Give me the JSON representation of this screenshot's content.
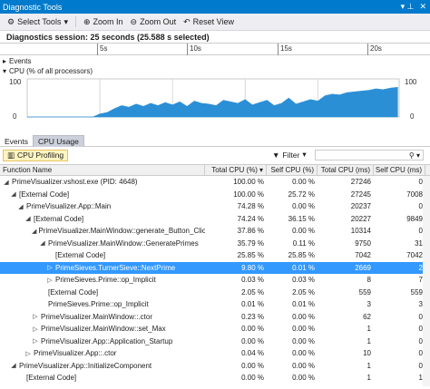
{
  "window": {
    "title": "Diagnostic Tools",
    "title_icons": [
      "pin-icon",
      "close-icon"
    ]
  },
  "toolbar": {
    "select_tools": "Select Tools",
    "zoom_in": "Zoom In",
    "zoom_out": "Zoom Out",
    "reset_view": "Reset View"
  },
  "session": {
    "text": "Diagnostics session: 25 seconds (25.588 s selected)"
  },
  "ruler": {
    "labels": [
      "5s",
      "10s",
      "15s",
      "20s"
    ]
  },
  "sections": {
    "events": "Events",
    "cpu": "CPU (% of all processors)"
  },
  "chart_data": {
    "type": "area",
    "title": "CPU (% of all processors)",
    "ylim": [
      0,
      100
    ],
    "y_ticks_left": [
      "100",
      "0"
    ],
    "y_ticks_right": [
      "100",
      "0"
    ],
    "xlim": [
      0,
      25.6
    ],
    "x_ticks": [
      "5s",
      "10s",
      "15s",
      "20s"
    ],
    "color": "#2b8fd6",
    "x": [
      0,
      0.5,
      1,
      1.5,
      2,
      2.5,
      3,
      3.5,
      4,
      4.5,
      5,
      5.5,
      6,
      6.5,
      7,
      7.5,
      8,
      8.5,
      9,
      9.5,
      10,
      10.5,
      11,
      11.5,
      12,
      12.5,
      13,
      13.5,
      14,
      14.5,
      15,
      15.5,
      16,
      16.5,
      17,
      17.5,
      18,
      18.5,
      19,
      19.5,
      20,
      20.5,
      21,
      21.5,
      22,
      22.5,
      23,
      23.5,
      24,
      24.5,
      25,
      25.5
    ],
    "values": [
      0,
      0,
      0,
      0,
      0,
      0,
      0,
      0,
      0,
      0,
      8,
      12,
      22,
      30,
      26,
      34,
      28,
      36,
      30,
      38,
      32,
      40,
      28,
      42,
      36,
      34,
      30,
      44,
      40,
      36,
      46,
      32,
      38,
      44,
      30,
      36,
      50,
      34,
      40,
      46,
      42,
      56,
      60,
      58,
      64,
      66,
      68,
      70,
      74,
      72,
      76,
      78
    ]
  },
  "tabs": [
    {
      "label": "Events"
    },
    {
      "label": "CPU Usage"
    }
  ],
  "subtoolbar": {
    "profiling": "CPU Profiling",
    "filter": "Filter"
  },
  "table": {
    "columns": [
      "Function Name",
      "Total CPU (%)",
      "Self CPU (%)",
      "Total CPU (ms)",
      "Self CPU (ms)"
    ],
    "rows": [
      {
        "indent": 0,
        "exp": "◢",
        "name": "PrimeVisualizer.vshost.exe (PID: 4648)",
        "tcp": "100.00 %",
        "scp": "0.00 %",
        "tms": "27246",
        "sms": "0"
      },
      {
        "indent": 1,
        "exp": "◢",
        "name": "[External Code]",
        "tcp": "100.00 %",
        "scp": "25.72 %",
        "tms": "27245",
        "sms": "7008"
      },
      {
        "indent": 2,
        "exp": "◢",
        "name": "PrimeVisualizer.App::Main",
        "tcp": "74.28 %",
        "scp": "0.00 %",
        "tms": "20237",
        "sms": "0"
      },
      {
        "indent": 3,
        "exp": "◢",
        "name": "[External Code]",
        "tcp": "74.24 %",
        "scp": "36.15 %",
        "tms": "20227",
        "sms": "9849"
      },
      {
        "indent": 4,
        "exp": "◢",
        "name": "PrimeVisualizer.MainWindow::generate_Button_Click",
        "tcp": "37.86 %",
        "scp": "0.00 %",
        "tms": "10314",
        "sms": "0"
      },
      {
        "indent": 5,
        "exp": "◢",
        "name": "PrimeVisualizer.MainWindow::GeneratePrimes",
        "tcp": "35.79 %",
        "scp": "0.11 %",
        "tms": "9750",
        "sms": "31"
      },
      {
        "indent": 6,
        "exp": "",
        "name": "[External Code]",
        "tcp": "25.85 %",
        "scp": "25.85 %",
        "tms": "7042",
        "sms": "7042"
      },
      {
        "indent": 6,
        "exp": "▷",
        "name": "PrimeSieves.TurnerSieve::NextPrime",
        "tcp": "9.80 %",
        "scp": "0.01 %",
        "tms": "2669",
        "sms": "2",
        "selected": true
      },
      {
        "indent": 6,
        "exp": "▷",
        "name": "PrimeSieves.Prime::op_Implicit",
        "tcp": "0.03 %",
        "scp": "0.03 %",
        "tms": "8",
        "sms": "7"
      },
      {
        "indent": 5,
        "exp": "",
        "name": "[External Code]",
        "tcp": "2.05 %",
        "scp": "2.05 %",
        "tms": "559",
        "sms": "559"
      },
      {
        "indent": 5,
        "exp": "",
        "name": "PrimeSieves.Prime::op_Implicit",
        "tcp": "0.01 %",
        "scp": "0.01 %",
        "tms": "3",
        "sms": "3"
      },
      {
        "indent": 4,
        "exp": "▷",
        "name": "PrimeVisualizer.MainWindow::.ctor",
        "tcp": "0.23 %",
        "scp": "0.00 %",
        "tms": "62",
        "sms": "0"
      },
      {
        "indent": 4,
        "exp": "▷",
        "name": "PrimeVisualizer.MainWindow::set_Max",
        "tcp": "0.00 %",
        "scp": "0.00 %",
        "tms": "1",
        "sms": "0"
      },
      {
        "indent": 4,
        "exp": "▷",
        "name": "PrimeVisualizer.App::Application_Startup",
        "tcp": "0.00 %",
        "scp": "0.00 %",
        "tms": "1",
        "sms": "0"
      },
      {
        "indent": 3,
        "exp": "▷",
        "name": "PrimeVisualizer.App::.ctor",
        "tcp": "0.04 %",
        "scp": "0.00 %",
        "tms": "10",
        "sms": "0"
      },
      {
        "indent": 1,
        "exp": "◢",
        "name": "PrimeVisualizer.App::InitializeComponent",
        "tcp": "0.00 %",
        "scp": "0.00 %",
        "tms": "1",
        "sms": "0"
      },
      {
        "indent": 2,
        "exp": "",
        "name": "[External Code]",
        "tcp": "0.00 %",
        "scp": "0.00 %",
        "tms": "1",
        "sms": "1"
      }
    ]
  }
}
